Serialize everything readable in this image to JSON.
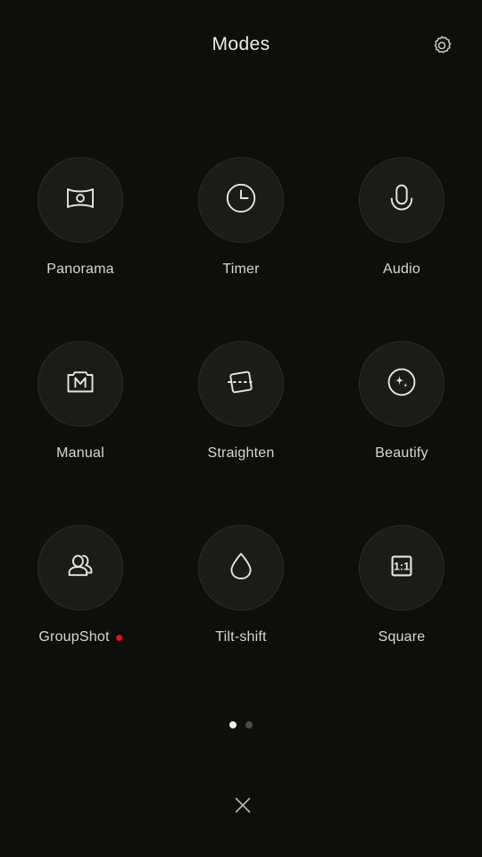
{
  "header": {
    "title": "Modes",
    "settings_icon": "gear-icon"
  },
  "theme": {
    "background": "#0e0e0c",
    "circle_fill": "#1b1b19",
    "circle_border": "#2b2b29",
    "icon_stroke": "#e8e6e2",
    "label_color": "#d9d7d3",
    "badge_color": "#e81010",
    "dot_active": "#f2f1ee",
    "dot_inactive": "#4a4a48"
  },
  "modes": [
    {
      "label": "Panorama",
      "icon": "panorama-icon",
      "badge": false
    },
    {
      "label": "Timer",
      "icon": "timer-icon",
      "badge": false
    },
    {
      "label": "Audio",
      "icon": "microphone-icon",
      "badge": false
    },
    {
      "label": "Manual",
      "icon": "manual-camera-icon",
      "badge": false
    },
    {
      "label": "Straighten",
      "icon": "straighten-icon",
      "badge": false
    },
    {
      "label": "Beautify",
      "icon": "sparkle-icon",
      "badge": false
    },
    {
      "label": "GroupShot",
      "icon": "group-people-icon",
      "badge": true
    },
    {
      "label": "Tilt-shift",
      "icon": "droplet-icon",
      "badge": false
    },
    {
      "label": "Square",
      "icon": "square-ratio-icon",
      "badge": false,
      "icon_text": "1:1"
    }
  ],
  "pager": {
    "total": 2,
    "active_index": 0
  },
  "close": {
    "icon": "close-icon"
  }
}
